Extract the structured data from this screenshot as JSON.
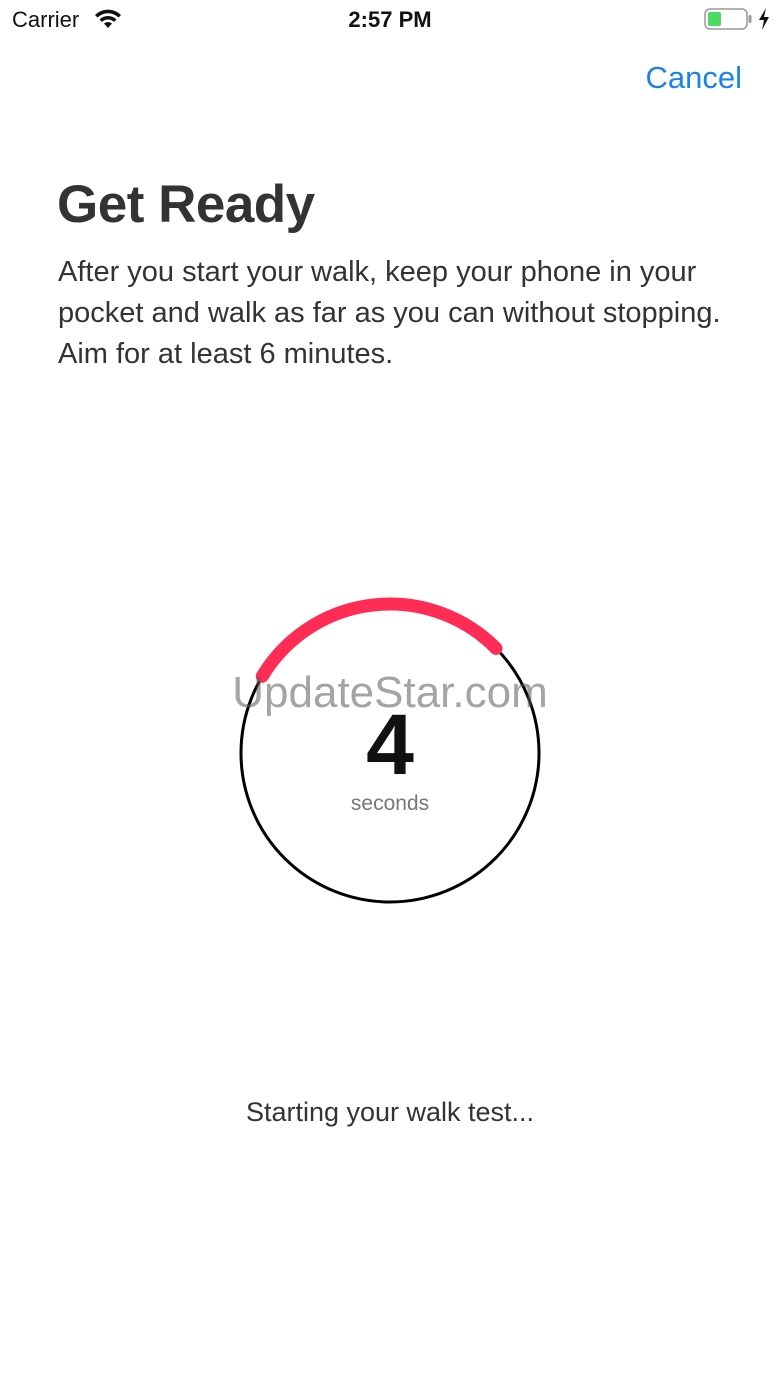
{
  "status_bar": {
    "carrier": "Carrier",
    "time": "2:57 PM",
    "battery_color": "#4cd964"
  },
  "nav": {
    "cancel_label": "Cancel"
  },
  "content": {
    "title": "Get Ready",
    "instructions": "After you start your walk, keep your phone in your pocket and walk as far as you can without stopping. Aim for at least 6 minutes."
  },
  "countdown": {
    "value": "4",
    "unit": "seconds",
    "progress_fraction": 0.29,
    "ring_color": "#000000",
    "progress_color": "#ff2d55",
    "watermark": "UpdateStar.com"
  },
  "status": {
    "message": "Starting your walk test..."
  },
  "accent_color": "#1a82e8"
}
